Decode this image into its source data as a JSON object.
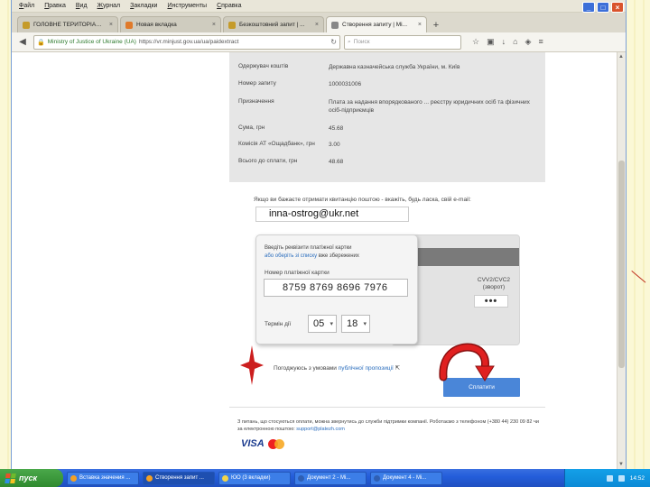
{
  "menubar": [
    "Файл",
    "Правка",
    "Вид",
    "Журнал",
    "Закладки",
    "Инструменты",
    "Справка"
  ],
  "tabs": [
    {
      "label": "ГОЛОВНЕ ТЕРИТОРІАЛЬНЕ ...",
      "active": false
    },
    {
      "label": "Новая вкладка",
      "active": false
    },
    {
      "label": "Безкоштовний запит | ...",
      "active": false
    },
    {
      "label": "Створення запиту | Мі...",
      "active": true
    }
  ],
  "nav": {
    "site_label": "Ministry of Justice of Ukraine (UA)",
    "url": "https://vr.minjust.gov.ua/ua/paidextract",
    "search_placeholder": "Поиск"
  },
  "info_rows": [
    {
      "key": "Одержувач коштів",
      "value": "Державна казначейська служба України, м. Київ"
    },
    {
      "key": "Номер запиту",
      "value": "1000031006"
    },
    {
      "key": "Призначення",
      "value": "Плата за надання впорядкованого ... реєстру юридичних осіб та фізичних осіб-підприємців"
    },
    {
      "key": "Сума, грн",
      "value": "45.68"
    },
    {
      "key": "Комісія АТ «Ощадбанк», грн",
      "value": "3.00"
    },
    {
      "key": "Всього до сплати, грн",
      "value": "48.68"
    }
  ],
  "email_note": "Якщо ви бажаєте отримати квитанцію поштою - вкажіть, будь ласка, свій e-mail:",
  "email_value": "inna-ostrog@ukr.net",
  "card": {
    "intro_text": "Введіть реквізити платіжної картки",
    "intro_link": "або оберіть зі списку",
    "intro_tail": "вже збережених",
    "number_label": "Номер платіжної картки",
    "number_value": "8759 8769 8696 7976",
    "term_label": "Термін дії",
    "month": "05",
    "year": "18",
    "cvv_label": "CVV2/CVC2",
    "cvv_sub": "(зворот)",
    "cvv_value": "•••"
  },
  "offer_text": "Погоджуюсь з умовами",
  "offer_link": "публічної пропозиції",
  "pay_button": "Сплатити",
  "footer_text": "З питань, що стосуються оплати, можна звернутись до служби підтримки компанії. Роботаємо з телефоном (+380 44) 230 09 82 чи за електронною поштою:",
  "footer_email": "support@platezh.com",
  "payment_logos": {
    "visa": "VISA"
  },
  "taskbar": {
    "start_label": "пуск",
    "tasks": [
      {
        "label": "Вставка значения ...",
        "active": false
      },
      {
        "label": "Створення запит ...",
        "active": true
      },
      {
        "label": "ЮО (3 вкладки)",
        "active": false
      },
      {
        "label": "Документ 2 - Mi...",
        "active": false
      },
      {
        "label": "Документ 4 - Mi...",
        "active": false
      }
    ],
    "clock": "14:52"
  },
  "colors": {
    "accent": "#4a86d8",
    "annotation": "#cc1f1f"
  }
}
